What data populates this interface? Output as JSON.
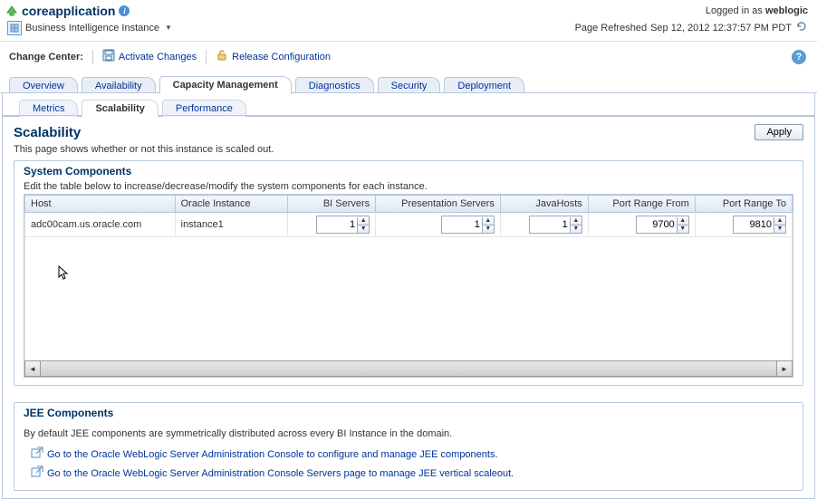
{
  "header": {
    "app_name": "coreapplication",
    "logged_in_prefix": "Logged in as ",
    "logged_in_user": "weblogic",
    "instance_label": "Business Intelligence Instance",
    "refresh_label": "Page Refreshed",
    "refresh_time": "Sep 12, 2012 12:37:57 PM PDT"
  },
  "change_center": {
    "label": "Change Center:",
    "activate": "Activate Changes",
    "release": "Release Configuration"
  },
  "tabs": {
    "overview": "Overview",
    "availability": "Availability",
    "capacity": "Capacity Management",
    "diagnostics": "Diagnostics",
    "security": "Security",
    "deployment": "Deployment"
  },
  "subtabs": {
    "metrics": "Metrics",
    "scalability": "Scalability",
    "performance": "Performance"
  },
  "section": {
    "title": "Scalability",
    "apply": "Apply",
    "desc": "This page shows whether or not this instance is scaled out."
  },
  "system": {
    "title": "System Components",
    "hint": "Edit the table below to increase/decrease/modify the system components for each instance.",
    "cols": {
      "host": "Host",
      "oracle_instance": "Oracle Instance",
      "bi_servers": "BI Servers",
      "presentation_servers": "Presentation Servers",
      "javahosts": "JavaHosts",
      "port_from": "Port Range From",
      "port_to": "Port Range To"
    },
    "row": {
      "host": "adc00cam.us.oracle.com",
      "oracle_instance": "instance1",
      "bi_servers": "1",
      "presentation_servers": "1",
      "javahosts": "1",
      "port_from": "9700",
      "port_to": "9810"
    }
  },
  "jee": {
    "title": "JEE Components",
    "desc": "By default JEE components are symmetrically distributed across every BI Instance in the domain.",
    "link1": "Go to the Oracle WebLogic Server Administration Console to configure and manage JEE components.",
    "link2": "Go to the Oracle WebLogic Server Administration Console Servers page to manage JEE vertical scaleout."
  }
}
